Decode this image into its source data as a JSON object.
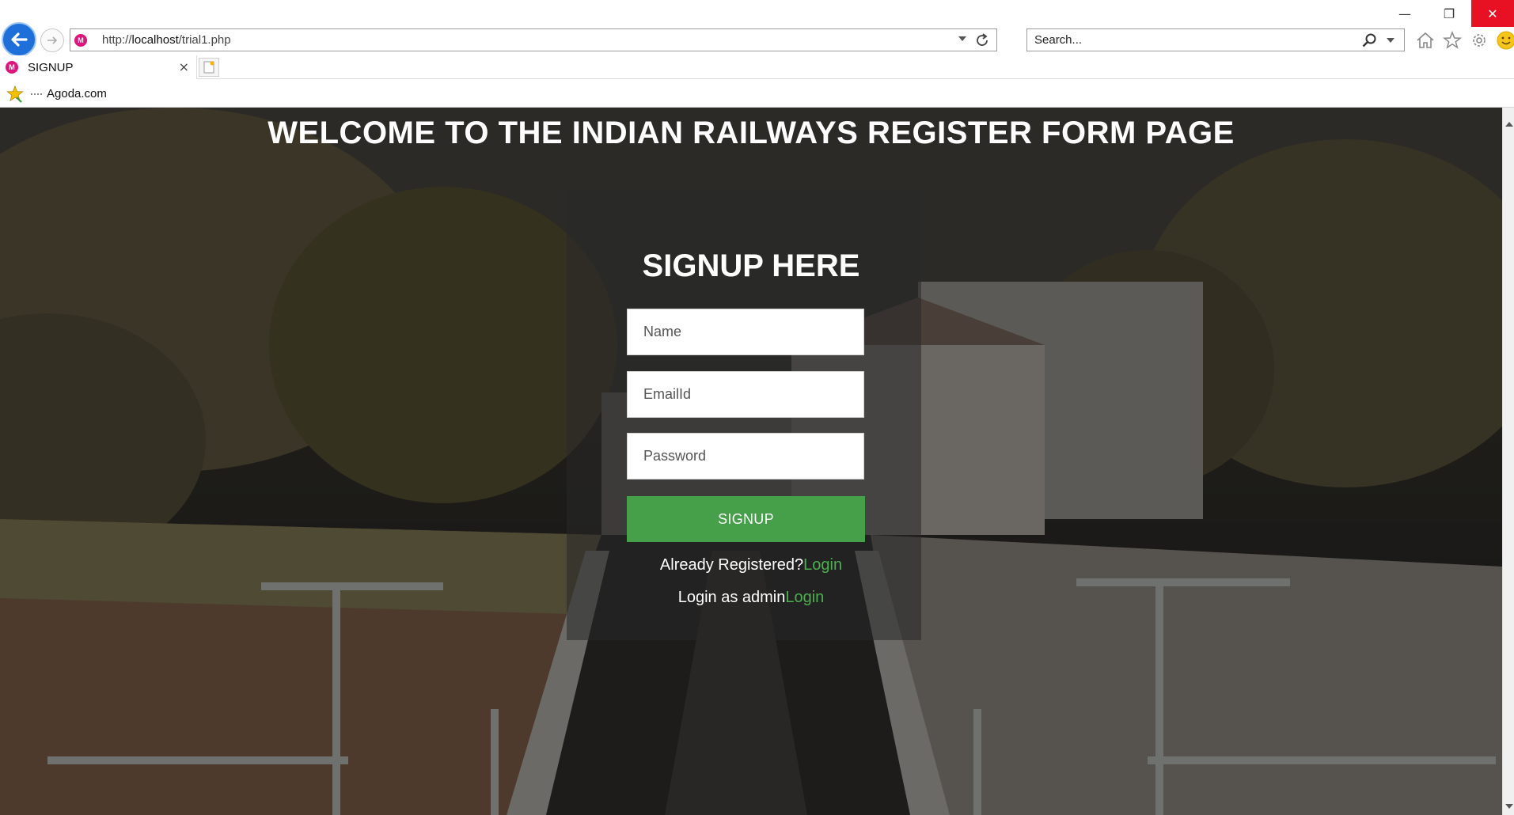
{
  "window": {
    "minimize_glyph": "—",
    "restore_glyph": "❐",
    "close_glyph": "✕"
  },
  "address_bar": {
    "url_prefix": "http://",
    "url_host": "localhost",
    "url_path": "/trial1.php",
    "favicon_letter": "M"
  },
  "search": {
    "placeholder": "Search..."
  },
  "tab": {
    "title": "SIGNUP",
    "close_glyph": "×"
  },
  "favorites": {
    "items": [
      {
        "label": "Agoda.com"
      }
    ]
  },
  "page": {
    "heading": "WELCOME TO THE INDIAN RAILWAYS REGISTER FORM PAGE",
    "form": {
      "title": "SIGNUP HERE",
      "name_placeholder": "Name",
      "email_placeholder": "EmailId",
      "password_placeholder": "Password",
      "submit_label": "SIGNUP",
      "registered_text": "Already Registered?",
      "registered_link": "Login",
      "admin_text": "Login as admin",
      "admin_link": "Login"
    }
  },
  "colors": {
    "accent_green": "#45a049",
    "link_green": "#4caf50",
    "browser_back": "#1e6fd9",
    "close_red": "#e81123"
  }
}
